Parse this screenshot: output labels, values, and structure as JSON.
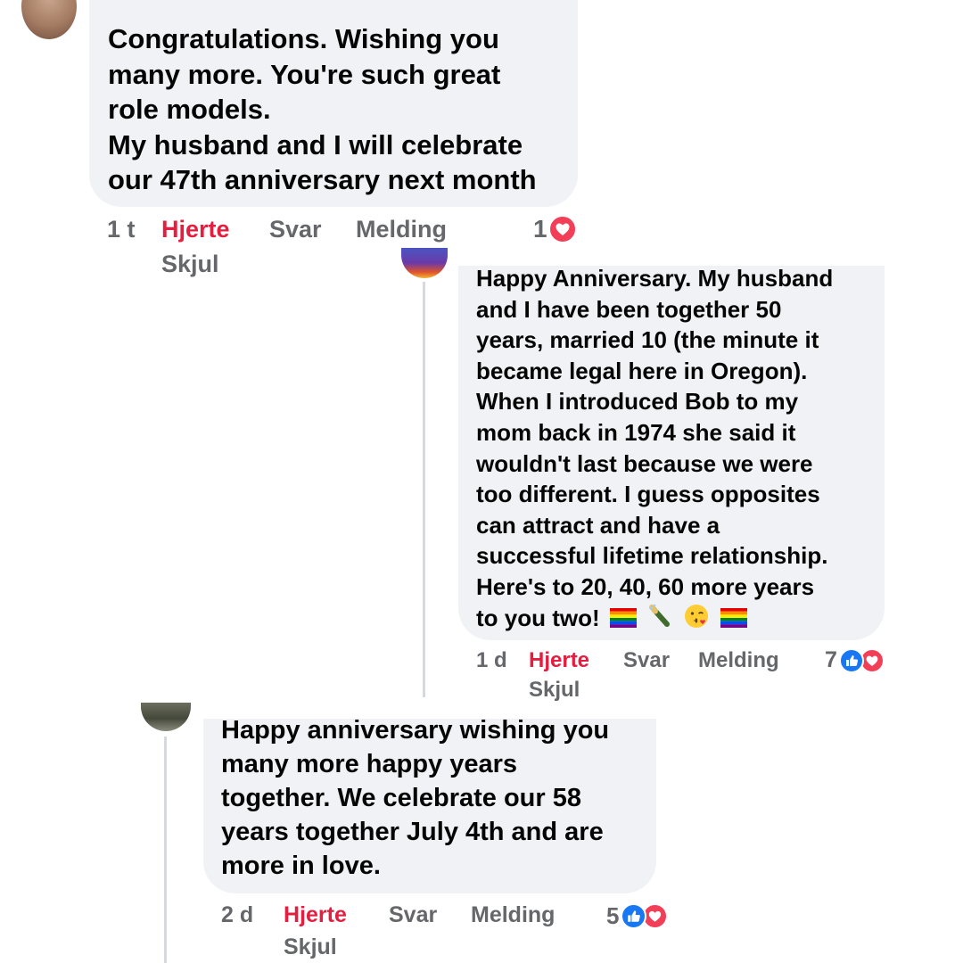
{
  "comments": [
    {
      "lines": [
        "Congratulations. Wishing you",
        "many more. You're such great",
        "role models.",
        "My husband and I will celebrate",
        "our 47th anniversary next month"
      ],
      "time": "1 t",
      "heart_label": "Hjerte",
      "reply_label": "Svar",
      "message_label": "Melding",
      "hide_label": "Skjul",
      "reaction_count": "1",
      "reactions": [
        "heart-icon"
      ]
    },
    {
      "lines": [
        "Happy Anniversary. My husband",
        "and I have been together 50",
        "years, married 10 (the minute it",
        "became legal here in Oregon).",
        "When I introduced Bob to my",
        "mom back in 1974 she said it",
        "wouldn't last because we were",
        "too different. I guess opposites",
        "can attract and have a",
        "successful lifetime relationship.",
        "Here's to 20, 40, 60 more years"
      ],
      "last_line": "to you two!",
      "emojis": [
        "rainbow-flag-icon",
        "champagne-bottle-icon",
        "kissing-face-icon",
        "rainbow-flag-icon"
      ],
      "time": "1 d",
      "heart_label": "Hjerte",
      "reply_label": "Svar",
      "message_label": "Melding",
      "hide_label": "Skjul",
      "reaction_count": "7",
      "reactions": [
        "like-icon",
        "heart-icon"
      ]
    },
    {
      "lines": [
        "Happy anniversary wishing you",
        "many more happy years",
        "together. We celebrate our 58",
        "years together July 4th and are",
        "more in love."
      ],
      "time": "2 d",
      "heart_label": "Hjerte",
      "reply_label": "Svar",
      "message_label": "Melding",
      "hide_label": "Skjul",
      "reaction_count": "5",
      "reactions": [
        "like-icon",
        "heart-icon"
      ]
    }
  ],
  "colors": {
    "bubble": "#f0f2f5",
    "heart_label": "#e41e3f",
    "muted": "#65676b",
    "like": "#1877f2",
    "love": "#f33e58"
  }
}
